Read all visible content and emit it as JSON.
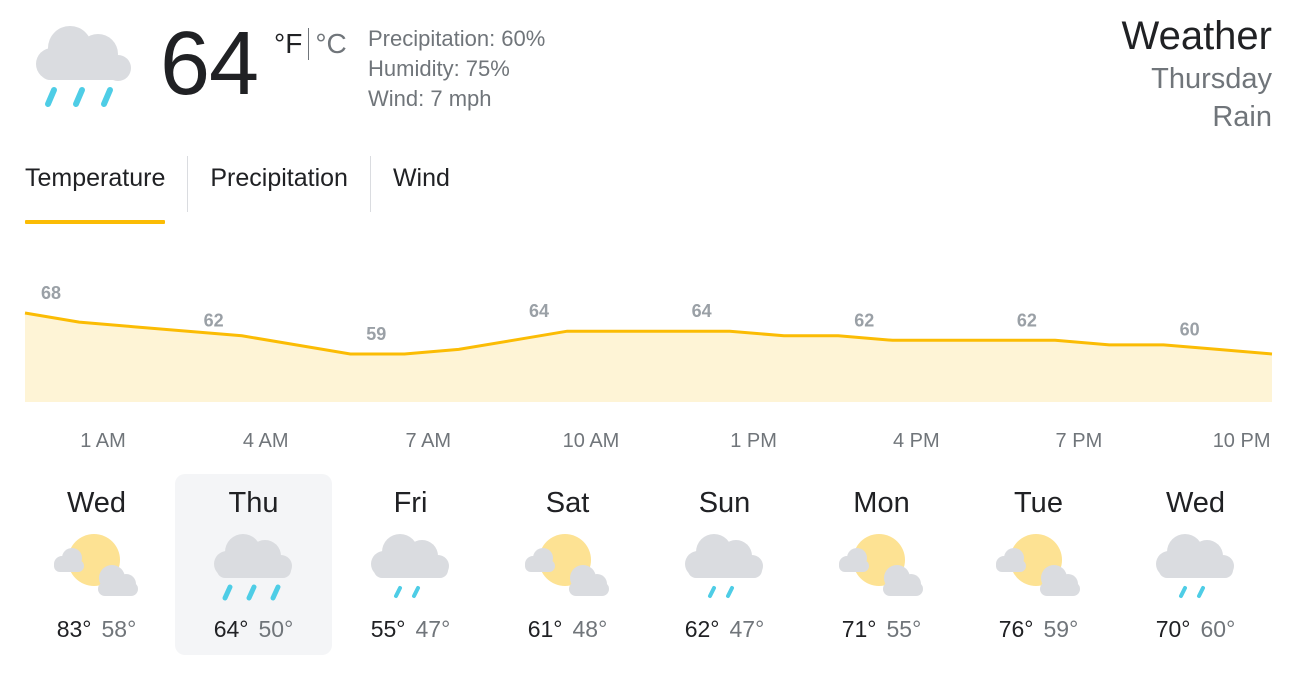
{
  "current": {
    "icon": "rain-cloud-icon",
    "temperature": "64",
    "unit_f": "°F",
    "unit_c": "°C",
    "precipitation": "Precipitation: 60%",
    "humidity": "Humidity: 75%",
    "wind": "Wind: 7 mph"
  },
  "header": {
    "title": "Weather",
    "day": "Thursday",
    "condition": "Rain"
  },
  "tabs": [
    {
      "label": "Temperature",
      "active": true
    },
    {
      "label": "Precipitation",
      "active": false
    },
    {
      "label": "Wind",
      "active": false
    }
  ],
  "colors": {
    "accent": "#fbbc04",
    "area_fill": "#fef4d6",
    "muted_text": "#70757a",
    "rain": "#4ecde6",
    "sun": "#fde293",
    "cloud": "#dadce0"
  },
  "chart_data": {
    "type": "area",
    "series": [
      {
        "x": [
          "1 AM",
          "2 AM",
          "3 AM",
          "4 AM",
          "5 AM",
          "6 AM",
          "7 AM",
          "8 AM",
          "9 AM",
          "10 AM",
          "11 AM",
          "12 PM",
          "1 PM",
          "2 PM",
          "3 PM",
          "4 PM",
          "5 PM",
          "6 PM",
          "7 PM",
          "8 PM",
          "9 PM",
          "10 PM",
          "11 PM",
          "12 AM"
        ],
        "values": [
          68,
          66,
          65,
          64,
          63,
          61,
          59,
          59,
          60,
          62,
          64,
          64,
          64,
          64,
          63,
          63,
          62,
          62,
          62,
          62,
          61,
          61,
          60,
          59
        ]
      }
    ],
    "data_labels": [
      {
        "x": "1 AM",
        "value": "68"
      },
      {
        "x": "4 AM",
        "value": "62"
      },
      {
        "x": "7 AM",
        "value": "59"
      },
      {
        "x": "10 AM",
        "value": "64"
      },
      {
        "x": "1 PM",
        "value": "64"
      },
      {
        "x": "4 PM",
        "value": "62"
      },
      {
        "x": "7 PM",
        "value": "62"
      },
      {
        "x": "10 PM",
        "value": "60"
      }
    ],
    "xticks": [
      "1 AM",
      "4 AM",
      "7 AM",
      "10 AM",
      "1 PM",
      "4 PM",
      "7 PM",
      "10 PM"
    ],
    "grid": false
  },
  "forecast": [
    {
      "day": "Wed",
      "icon": "partly-cloudy-icon",
      "high": "83°",
      "low": "58°",
      "selected": false
    },
    {
      "day": "Thu",
      "icon": "rain-cloud-icon",
      "high": "64°",
      "low": "50°",
      "selected": true
    },
    {
      "day": "Fri",
      "icon": "showers-icon",
      "high": "55°",
      "low": "47°",
      "selected": false
    },
    {
      "day": "Sat",
      "icon": "partly-cloudy-icon",
      "high": "61°",
      "low": "48°",
      "selected": false
    },
    {
      "day": "Sun",
      "icon": "showers-icon",
      "high": "62°",
      "low": "47°",
      "selected": false
    },
    {
      "day": "Mon",
      "icon": "partly-cloudy-icon",
      "high": "71°",
      "low": "55°",
      "selected": false
    },
    {
      "day": "Tue",
      "icon": "partly-cloudy-icon",
      "high": "76°",
      "low": "59°",
      "selected": false
    },
    {
      "day": "Wed",
      "icon": "showers-icon",
      "high": "70°",
      "low": "60°",
      "selected": false
    }
  ]
}
